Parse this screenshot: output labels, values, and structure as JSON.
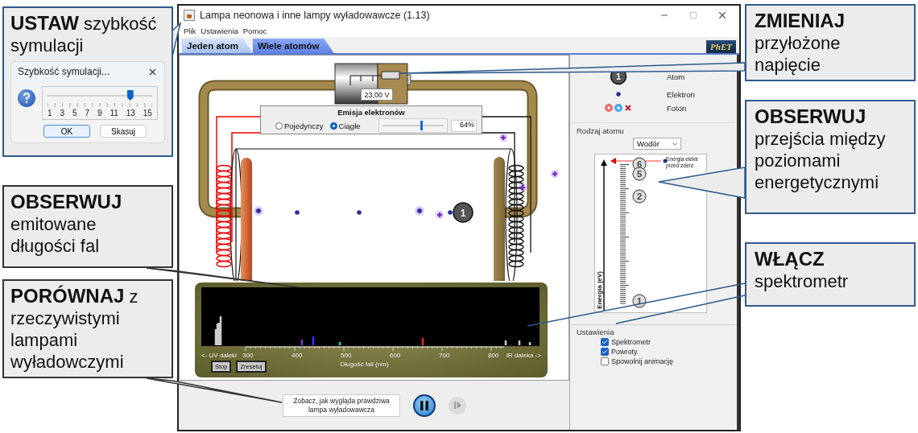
{
  "left_callouts": [
    {
      "text": "**USTAW** szybkość symulacji",
      "dialog": {
        "title": "Szybkość symulacji...",
        "ticks": [
          "1",
          "3",
          "5",
          "7",
          "9",
          "11",
          "13",
          "15"
        ],
        "level": 0.79,
        "buttons": [
          {
            "label": "OK",
            "default": true
          },
          {
            "label": "Skasuj",
            "default": false
          }
        ]
      }
    },
    {
      "text": "**OBSERWUJ** emitowane długości fal"
    },
    {
      "text": "**PORÓWNAJ** z rzeczywistymi lampami wyładowczymi"
    }
  ],
  "window": {
    "title": "Lampa neonowa i inne lampy wyładowawcze (1.13)",
    "menu": [
      "Plik",
      "Ustawienia",
      "Pomoc"
    ],
    "tabs": [
      {
        "label": "Jeden atom",
        "selected": true
      },
      {
        "label": "Wiele atomów",
        "selected": false
      }
    ],
    "logo": "PhET"
  },
  "simulation": {
    "voltage": "23,00 V",
    "atom_label": "1",
    "emission": {
      "title": "Emisja elektronów",
      "modes": [
        {
          "label": "Pojedynczy",
          "selected": false
        },
        {
          "label": "Ciągłe",
          "selected": true
        }
      ],
      "level": 0.64,
      "reading": "64%"
    },
    "spectrometer": {
      "uv_label": "<- UV daleki",
      "axis_labels": [
        "300",
        "400",
        "500",
        "600",
        "700",
        "800"
      ],
      "ir_label": "IR daleka ->",
      "xlabel": "Długość fali (nm)",
      "buttons": [
        "Stop",
        "Zresetuj"
      ]
    }
  },
  "panel": {
    "legend": [
      {
        "kind": "atom",
        "label": "Atom",
        "symbol": "1"
      },
      {
        "kind": "electron",
        "label": "Elektron"
      },
      {
        "kind": "photon",
        "label": "Foton"
      }
    ],
    "atom_type": {
      "title": "Rodzaj atomu",
      "value": "Wodór"
    },
    "energy_diagram": {
      "axis_label": "Energia (eV)",
      "electron_label": "Energia elektr przed zderz.",
      "levels": [
        "6",
        "5",
        "2",
        "1"
      ]
    },
    "settings": {
      "title": "Ustawienia",
      "options": [
        {
          "label": "Spektrometr",
          "checked": true
        },
        {
          "label": "Powroty",
          "checked": true
        },
        {
          "label": "Spowolnij animację",
          "checked": false
        }
      ]
    }
  },
  "controls": {
    "real_lamp_button": "Zobacz, jak wygląda prawdziwa lampa wyładowawcza"
  },
  "right_callouts": [
    {
      "text": "**ZMIENIAJ** przyłożone napięcie"
    },
    {
      "text": "**OBSERWUJ** przejścia między poziomami energetycznymi"
    },
    {
      "text": "**WŁĄCZ** spektrometr"
    }
  ]
}
